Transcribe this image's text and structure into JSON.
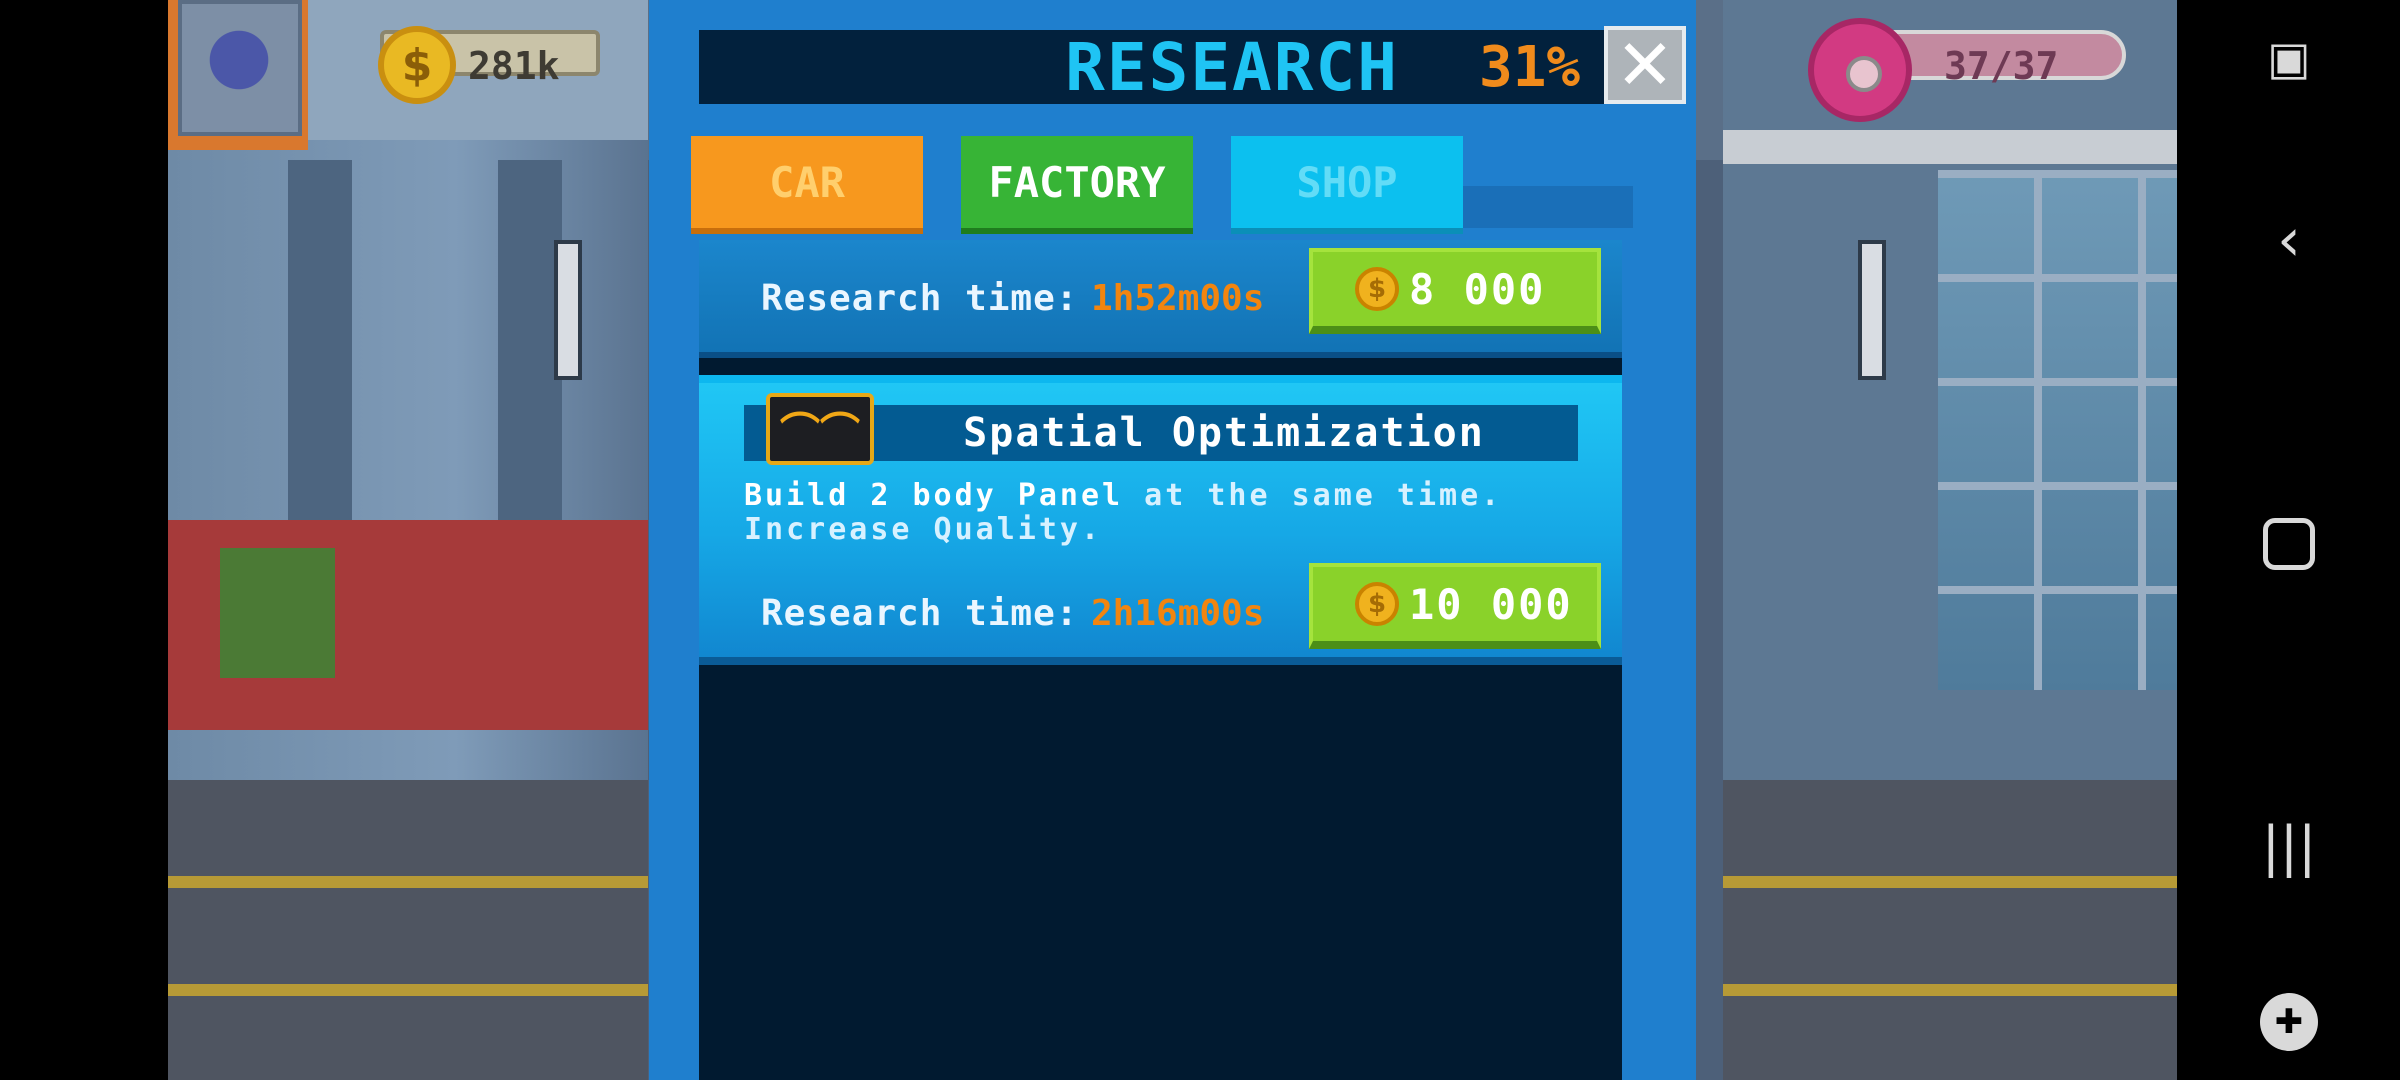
{
  "hud": {
    "coins": "281k",
    "donuts": "37/37"
  },
  "research": {
    "title": "RESEARCH",
    "percent": "31%",
    "close_icon": "close-icon"
  },
  "tabs": [
    {
      "label": "CAR"
    },
    {
      "label": "FACTORY"
    },
    {
      "label": "SHOP"
    }
  ],
  "items": [
    {
      "research_label": "Research time:",
      "research_time": "1h52m00s",
      "cost": "8 000"
    },
    {
      "title": "Spatial Optimization",
      "icon": "double-arch-icon",
      "description_parts": [
        "Build 2 body Panel",
        " at the same time."
      ],
      "description_line2": "Increase Quality.",
      "research_label": "Research time:",
      "research_time": "2h16m00s",
      "cost": "10 000"
    }
  ],
  "navbar": {
    "icons": [
      "screenshot-icon",
      "back-icon",
      "home-icon",
      "recents-icon",
      "game-launcher-icon"
    ]
  },
  "colors": {
    "modal": "#1f7fce",
    "title_text": "#1fc4f4",
    "percent": "#f08b1c",
    "tab_car": "#f7981e",
    "tab_factory": "#37b436",
    "tab_shop": "#0cc0ef",
    "cost_button": "#8ad22a"
  }
}
